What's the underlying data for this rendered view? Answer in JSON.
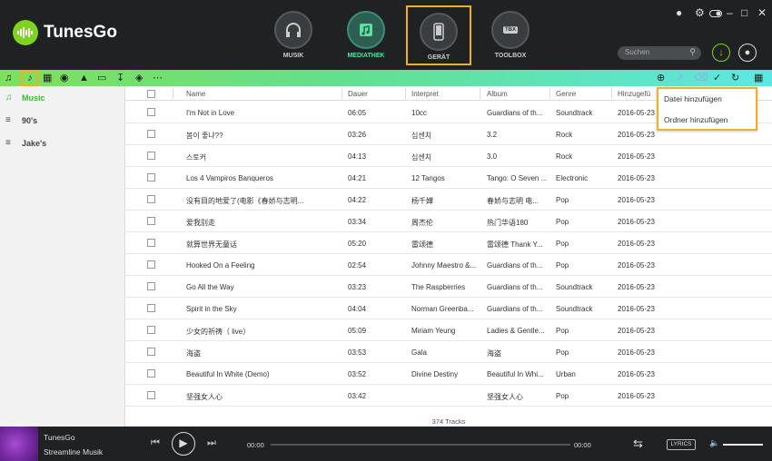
{
  "app": {
    "title": "TunesGo"
  },
  "nav": {
    "tabs": [
      {
        "label": "MUSIK"
      },
      {
        "label": "MEDIATHEK"
      },
      {
        "label": "GERÄT"
      },
      {
        "label": "TOOLBOX"
      }
    ],
    "toolbox_badge": "TBX"
  },
  "search": {
    "placeholder": "Suchen"
  },
  "sidebar": {
    "items": [
      {
        "label": "Music"
      },
      {
        "label": "90's"
      },
      {
        "label": "Jake's"
      }
    ]
  },
  "table": {
    "headers": [
      "Name",
      "Dauer",
      "Interpret",
      "Album",
      "Genre",
      "Hinzugefü"
    ],
    "rows": [
      [
        "I'm Not in Love",
        "06:05",
        "10cc",
        "Guardians of th...",
        "Soundtrack",
        "2016-05-23"
      ],
      [
        "봄이 좋냐??",
        "03:26",
        "십센치",
        "3.2",
        "Rock",
        "2016-05-23"
      ],
      [
        "스토커",
        "04:13",
        "십센치",
        "3.0",
        "Rock",
        "2016-05-23"
      ],
      [
        "Los 4 Vampiros Banqueros",
        "04:21",
        "12 Tangos",
        "Tango: O Seven ...",
        "Electronic",
        "2016-05-23"
      ],
      [
        "没有目的地爱了(电影《春娇与志明...",
        "04:22",
        "杨千嬅",
        "春娇与志明 电...",
        "Pop",
        "2016-05-23"
      ],
      [
        "爱我别走",
        "03:34",
        "周杰伦",
        "热门华语180",
        "Pop",
        "2016-05-23"
      ],
      [
        "就算世界无童话",
        "05:20",
        "雷颂德",
        "雷颂德 Thank Y...",
        "Pop",
        "2016-05-23"
      ],
      [
        "Hooked On a Feeling",
        "02:54",
        "Johnny Maestro &...",
        "Guardians of th...",
        "Pop",
        "2016-05-23"
      ],
      [
        "Go All the Way",
        "03:23",
        "The Raspberries",
        "Guardians of th...",
        "Soundtrack",
        "2016-05-23"
      ],
      [
        "Spirit in the Sky",
        "04:04",
        "Norman Greenba...",
        "Guardians of th...",
        "Soundtrack",
        "2016-05-23"
      ],
      [
        "少女的祈祷（ live）",
        "05:09",
        "Miriam Yeung",
        "Ladies & Gentle...",
        "Pop",
        "2016-05-23"
      ],
      [
        "海盗",
        "03:53",
        "Gala",
        "海盗",
        "Pop",
        "2016-05-23"
      ],
      [
        "Beautiful In White (Demo)",
        "03:52",
        "Divine Destiny",
        "Beautiful In Whi...",
        "Urban",
        "2016-05-23"
      ],
      [
        "坚强女人心",
        "03:42",
        "",
        "坚强女人心",
        "Pop",
        "2016-05-23"
      ]
    ],
    "count": "374 Tracks"
  },
  "dropdown": {
    "items": [
      "Datei hinzufügen",
      "Ordner hinzufügen"
    ]
  },
  "player": {
    "line1": "TunesGo",
    "line2": "Streamline Musik",
    "time_start": "00:00",
    "time_end": "00:00",
    "lyrics": "LYRICS"
  },
  "colors": {
    "accent": "#7ed321",
    "highlight": "#f2b01e",
    "active_text": "#3cb839"
  }
}
